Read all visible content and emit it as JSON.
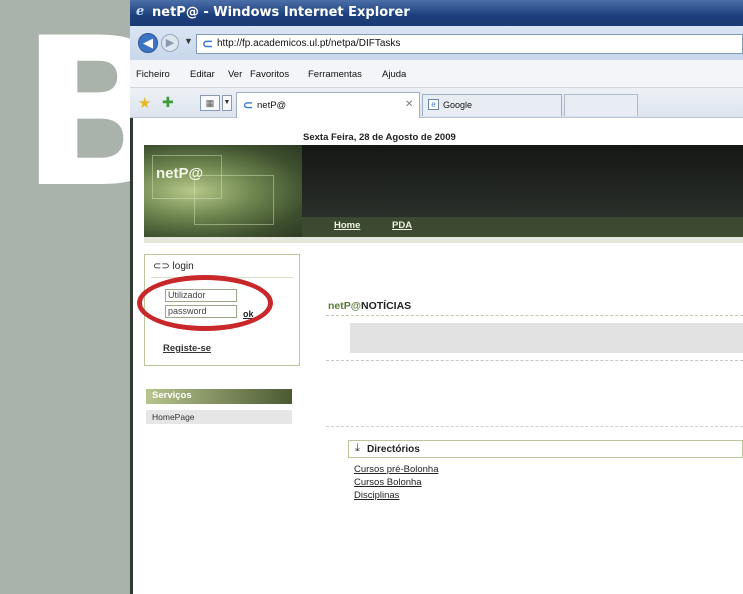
{
  "window": {
    "title": "netP@ - Windows Internet Explorer"
  },
  "address": {
    "url": "http://fp.academicos.ul.pt/netpa/DIFTasks"
  },
  "menu": [
    "Ficheiro",
    "Editar",
    "Ver",
    "Favoritos",
    "Ferramentas",
    "Ajuda"
  ],
  "tabs": {
    "active": "netP@",
    "other": "Google"
  },
  "page": {
    "date": "Sexta Feira, 28 de Agosto de 2009",
    "logo": "netP@",
    "nav": [
      "Home",
      "PDA"
    ],
    "login": {
      "title": "login",
      "username_placeholder": "Utilizador",
      "password_placeholder": "password",
      "ok": "ok",
      "register": "Registe-se"
    },
    "services": {
      "title": "Serviços",
      "items": [
        "HomePage"
      ]
    },
    "news": {
      "brand": "netP@",
      "title": "NOTÍCIAS"
    },
    "directories": {
      "title": "Directórios",
      "links": [
        "Cursos pré-Bolonha",
        "Cursos Bolonha",
        "Disciplinas"
      ]
    }
  },
  "decor": {
    "margin_letter": "B",
    "highlight_color": "#c8282a",
    "titlebar_color": "#1c3f7c",
    "theme_green": "#4b5a32"
  }
}
